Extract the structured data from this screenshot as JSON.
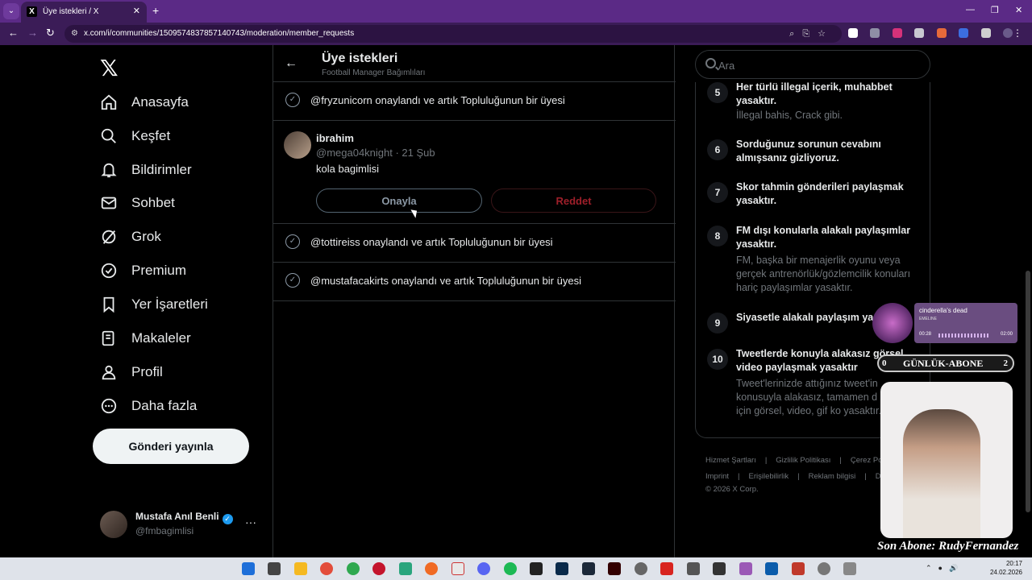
{
  "browser": {
    "tab_title": "Üye istekleri / X",
    "url": "x.com/i/communities/1509574837857140743/moderation/member_requests"
  },
  "sidebar": {
    "items": [
      {
        "label": "Anasayfa",
        "icon": "home-icon"
      },
      {
        "label": "Keşfet",
        "icon": "search-icon"
      },
      {
        "label": "Bildirimler",
        "icon": "bell-icon"
      },
      {
        "label": "Sohbet",
        "icon": "mail-icon"
      },
      {
        "label": "Grok",
        "icon": "grok-icon"
      },
      {
        "label": "Premium",
        "icon": "premium-icon"
      },
      {
        "label": "Yer İşaretleri",
        "icon": "bookmark-icon"
      },
      {
        "label": "Makaleler",
        "icon": "article-icon"
      },
      {
        "label": "Profil",
        "icon": "profile-icon"
      },
      {
        "label": "Daha fazla",
        "icon": "more-icon"
      }
    ],
    "post_button": "Gönderi yayınla",
    "account": {
      "name": "Mustafa Anıl Benli",
      "handle": "@fmbagimlisi",
      "more": "···"
    }
  },
  "main": {
    "title": "Üye istekleri",
    "subtitle": "Football Manager Bağımlıları",
    "approved_rows": [
      "@fryzunicorn onaylandı ve artık Topluluğunun bir üyesi",
      "@tottireiss onaylandı ve artık Topluluğunun bir üyesi",
      "@mustafacakirts onaylandı ve artık Topluluğunun bir üyesi"
    ],
    "request": {
      "name": "ibrahim",
      "handle": "@mega04knight · 21 Şub",
      "bio": "kola bagimlisi",
      "approve": "Onayla",
      "reject": "Reddet"
    }
  },
  "right": {
    "search_placeholder": "Ara",
    "rules": [
      {
        "num": "5",
        "title": "Her türlü illegal içerik, muhabbet yasaktır.",
        "desc": "İllegal bahis, Crack gibi."
      },
      {
        "num": "6",
        "title": "Sorduğunuz sorunun cevabını almışsanız gizliyoruz.",
        "desc": ""
      },
      {
        "num": "7",
        "title": "Skor tahmin gönderileri paylaşmak yasaktır.",
        "desc": ""
      },
      {
        "num": "8",
        "title": "FM dışı konularla alakalı paylaşımlar yasaktır.",
        "desc": "FM, başka bir menajerlik oyunu veya gerçek antrenörlük/gözlemcilik konuları hariç paylaşımlar yasaktır."
      },
      {
        "num": "9",
        "title": "Siyasetle alakalı paylaşım ya",
        "desc": ""
      },
      {
        "num": "10",
        "title": "Tweetlerde konuyla alakasız görsel, video paylaşmak yasaktır",
        "desc": "Tweet'lerinizde attığınız tweet'in konusuyla alakasız, tamamen d çekmek için görsel, video, gif ko yasaktır."
      }
    ],
    "footer": {
      "line1": [
        "Hizmet Şartları",
        "|",
        "Gizlilik Politikası",
        "|",
        "Çerez Politi"
      ],
      "line2": [
        "Imprint",
        "|",
        "Erişilebilirlik",
        "|",
        "Reklam bilgisi",
        "|",
        "Daha"
      ],
      "copyright": "© 2026 X Corp."
    }
  },
  "overlay": {
    "song": "cinderella's dead",
    "artist": "EMELINE",
    "time_current": "00:28",
    "time_total": "02:00",
    "abone_left": "0",
    "abone_label": "GÜNLÜK-ABONE",
    "abone_right": "2",
    "last_sub": "Son Abone: RudyFernandez"
  },
  "taskbar": {
    "time": "20:17",
    "date": "24.02.2026"
  },
  "colors": {
    "browser_purple": "#5b2a86",
    "verified_blue": "#1d9bf0",
    "reject_red": "#9e1f2a"
  }
}
